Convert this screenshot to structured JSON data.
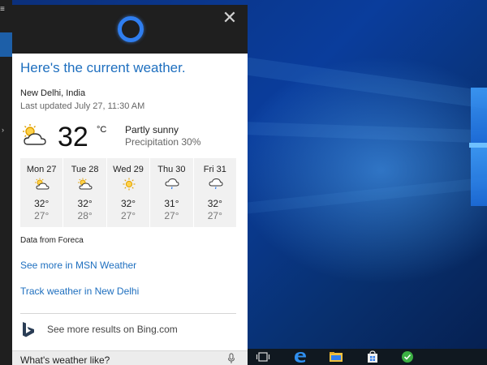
{
  "cortana": {
    "headline": "Here's the current weather.",
    "location": "New Delhi, India",
    "last_updated": "Last updated July 27, 11:30 AM",
    "current": {
      "temperature": "32",
      "unit": "°C",
      "condition": "Partly sunny",
      "precipitation": "Precipitation 30%",
      "icon": "partly-sunny-icon"
    },
    "forecast": [
      {
        "day": "Mon 27",
        "high": "32°",
        "low": "27°",
        "icon": "partly-sunny-icon"
      },
      {
        "day": "Tue 28",
        "high": "32°",
        "low": "28°",
        "icon": "partly-sunny-icon"
      },
      {
        "day": "Wed 29",
        "high": "32°",
        "low": "27°",
        "icon": "sunny-icon"
      },
      {
        "day": "Thu 30",
        "high": "31°",
        "low": "27°",
        "icon": "rain-icon"
      },
      {
        "day": "Fri 31",
        "high": "32°",
        "low": "27°",
        "icon": "rain-icon"
      }
    ],
    "source": "Data from Foreca",
    "links": {
      "msn_weather": "See more in MSN Weather",
      "track_weather": "Track weather in New Delhi"
    },
    "bing": "See more results on Bing.com",
    "search_query": "What's weather like?"
  },
  "colors": {
    "accent": "#1e6fbf",
    "cortana_ring": "#2f7ef0",
    "header_bg": "#1f1f1f"
  },
  "taskbar_icons": [
    "task-view-icon",
    "edge-icon",
    "file-explorer-icon",
    "store-icon",
    "app-icon"
  ]
}
